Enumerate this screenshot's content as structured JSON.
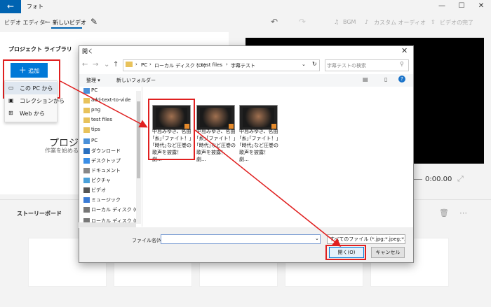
{
  "app": {
    "back_icon": "back-arrow-icon",
    "title": "フォト",
    "window_buttons": [
      "—",
      "☐",
      "✕"
    ]
  },
  "toolbar": {
    "breadcrumb_editor": "ビデオ エディター",
    "separator": ">",
    "tab_active": "新しいビデオ",
    "bgm_label": "BGM",
    "custom_audio_label": "カスタム オーディオ",
    "finish_label": "ビデオの完了"
  },
  "project": {
    "title": "プロジェクト ライブラリ",
    "add_button": "追加",
    "menu_items": [
      "この PC から",
      "コレクションから",
      "Web から"
    ],
    "placeholder_title": "プロジ",
    "placeholder_sub": "作業を始めるに"
  },
  "preview": {
    "time": "0:00.00"
  },
  "storyboard": {
    "title": "ストーリーボード"
  },
  "dialog": {
    "title": "開く",
    "path": [
      "PC",
      "ローカル ディスク (D:)",
      "test files",
      "字幕テスト"
    ],
    "search_placeholder": "字幕テストの検索",
    "organize_label": "整理 ▾",
    "new_folder_label": "新しいフォルダー",
    "nav_items": [
      {
        "label": "PC",
        "icon": "pc-icon"
      },
      {
        "label": "add-text-to-vide",
        "icon": "folder-icon"
      },
      {
        "label": "png",
        "icon": "folder-icon"
      },
      {
        "label": "test files",
        "icon": "folder-icon"
      },
      {
        "label": "tips",
        "icon": "folder-icon"
      },
      {
        "label": "PC",
        "icon": "pc-icon"
      },
      {
        "label": "ダウンロード",
        "icon": "download-icon"
      },
      {
        "label": "デスクトップ",
        "icon": "desktop-icon"
      },
      {
        "label": "ドキュメント",
        "icon": "document-icon"
      },
      {
        "label": "ピクチャ",
        "icon": "picture-icon"
      },
      {
        "label": "ビデオ",
        "icon": "video-icon"
      },
      {
        "label": "ミュージック",
        "icon": "music-icon"
      },
      {
        "label": "ローカル ディスク (C",
        "icon": "disk-icon"
      },
      {
        "label": "ローカル ディスク (D",
        "icon": "disk-icon"
      }
    ],
    "files": [
      {
        "caption": "中島みゆき、名曲｢糸｣｢ファイト！｣｢時代｣など圧巻の歌声を披露！　劇..."
      },
      {
        "caption": "中島みゆき、名曲｢糸｣｢ファイト！｣｢時代｣など圧巻の歌声を披露！　劇..."
      },
      {
        "caption": "中島みゆき、名曲｢糸｣｢ファイト！｣｢時代｣など圧巻の歌声を披露！　劇..."
      }
    ],
    "filename_label": "ファイル名(N):",
    "filename_value": "",
    "filter_label": "すべてのファイル (*.jpg;*.jpeg;*.thu",
    "open_button": "開く(O)",
    "cancel_button": "キャンセル"
  },
  "colors": {
    "accent": "#0078d7",
    "highlight": "#e02020"
  }
}
